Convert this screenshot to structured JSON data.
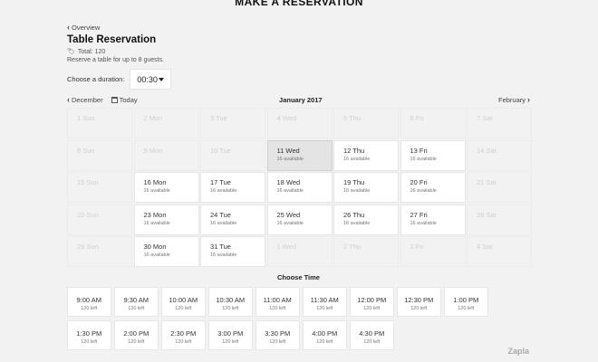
{
  "header": {
    "page_title": "MAKE A RESERVATION"
  },
  "reservation": {
    "back_label": "Overview",
    "title": "Table Reservation",
    "total": "Total: 120",
    "description": "Reserve a table for up to 8 guests.",
    "duration_label": "Choose a duration:",
    "duration_value": "00:30"
  },
  "calendar": {
    "prev_label": "December",
    "today_label": "Today",
    "month_label": "January 2017",
    "next_label": "February",
    "cells": [
      {
        "day": "1 Sun",
        "status": "disabled"
      },
      {
        "day": "2 Mon",
        "status": "disabled"
      },
      {
        "day": "3 Tue",
        "status": "disabled"
      },
      {
        "day": "4 Wed",
        "status": "disabled"
      },
      {
        "day": "5 Thu",
        "status": "disabled"
      },
      {
        "day": "6 Fri",
        "status": "disabled"
      },
      {
        "day": "7 Sat",
        "status": "disabled"
      },
      {
        "day": "8 Sun",
        "status": "disabled"
      },
      {
        "day": "9 Mon",
        "status": "disabled"
      },
      {
        "day": "10 Tue",
        "status": "disabled"
      },
      {
        "day": "11 Wed",
        "status": "selected",
        "sub": "16 available"
      },
      {
        "day": "12 Thu",
        "status": "available",
        "sub": "16 available"
      },
      {
        "day": "13 Fri",
        "status": "available",
        "sub": "16 available"
      },
      {
        "day": "14 Sat",
        "status": "disabled"
      },
      {
        "day": "15 Sun",
        "status": "disabled"
      },
      {
        "day": "16 Mon",
        "status": "available",
        "sub": "16 available"
      },
      {
        "day": "17 Tue",
        "status": "available",
        "sub": "16 available"
      },
      {
        "day": "18 Wed",
        "status": "available",
        "sub": "16 available"
      },
      {
        "day": "19 Thu",
        "status": "available",
        "sub": "16 available"
      },
      {
        "day": "20 Fri",
        "status": "available",
        "sub": "16 available"
      },
      {
        "day": "21 Sat",
        "status": "disabled"
      },
      {
        "day": "22 Sun",
        "status": "disabled"
      },
      {
        "day": "23 Mon",
        "status": "available",
        "sub": "16 available"
      },
      {
        "day": "24 Tue",
        "status": "available",
        "sub": "16 available"
      },
      {
        "day": "25 Wed",
        "status": "available",
        "sub": "16 available"
      },
      {
        "day": "26 Thu",
        "status": "available",
        "sub": "16 available"
      },
      {
        "day": "27 Fri",
        "status": "available",
        "sub": "16 available"
      },
      {
        "day": "28 Sat",
        "status": "disabled"
      },
      {
        "day": "29 Sun",
        "status": "disabled"
      },
      {
        "day": "30 Mon",
        "status": "available",
        "sub": "16 available"
      },
      {
        "day": "31 Tue",
        "status": "available",
        "sub": "16 available"
      },
      {
        "day": "1 Wed",
        "status": "disabled"
      },
      {
        "day": "2 Thu",
        "status": "disabled"
      },
      {
        "day": "3 Fri",
        "status": "disabled"
      },
      {
        "day": "4 Sat",
        "status": "disabled"
      }
    ]
  },
  "times": {
    "title": "Choose Time",
    "slots": [
      {
        "time": "9:00 AM",
        "left": "120 left"
      },
      {
        "time": "9:30 AM",
        "left": "120 left"
      },
      {
        "time": "10:00 AM",
        "left": "120 left"
      },
      {
        "time": "10:30 AM",
        "left": "120 left"
      },
      {
        "time": "11:00 AM",
        "left": "120 left"
      },
      {
        "time": "11:30 AM",
        "left": "120 left"
      },
      {
        "time": "12:00 PM",
        "left": "120 left"
      },
      {
        "time": "12:30 PM",
        "left": "120 left"
      },
      {
        "time": "1:00 PM",
        "left": "120 left"
      },
      {
        "time": "1:30 PM",
        "left": "120 left"
      },
      {
        "time": "2:00 PM",
        "left": "120 left"
      },
      {
        "time": "2:30 PM",
        "left": "120 left"
      },
      {
        "time": "3:00 PM",
        "left": "120 left"
      },
      {
        "time": "3:30 PM",
        "left": "120 left"
      },
      {
        "time": "4:00 PM",
        "left": "120 left"
      },
      {
        "time": "4:30 PM",
        "left": "120 left"
      }
    ]
  },
  "footer": {
    "brand": "Zapla"
  }
}
